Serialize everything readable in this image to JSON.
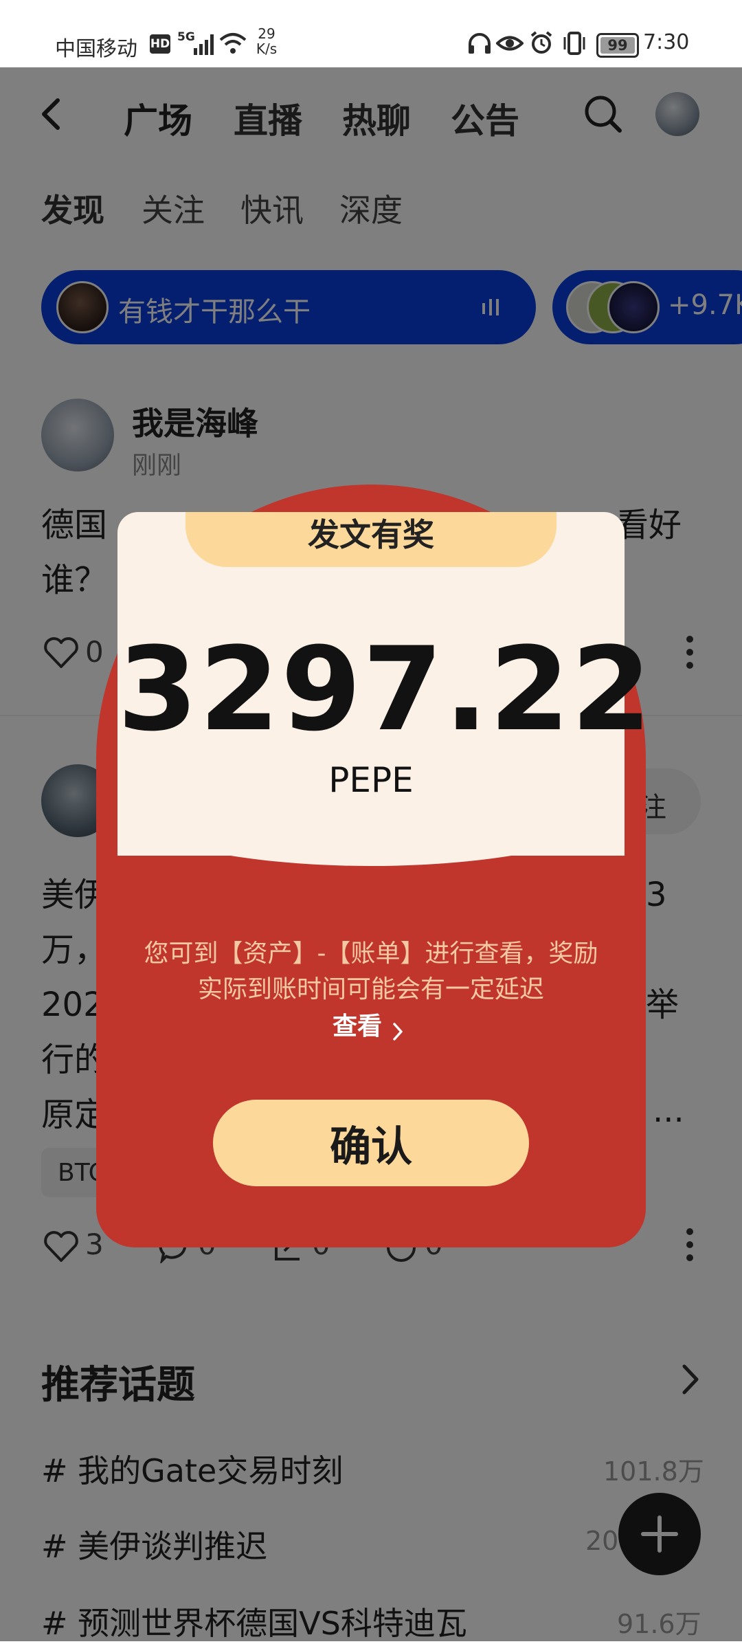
{
  "status": {
    "carrier": "中国移动",
    "hd": "HD",
    "signal": "5G",
    "speed_value": "29",
    "speed_unit": "K/s",
    "battery": "99",
    "time": "7:30"
  },
  "nav": {
    "tabs": [
      {
        "label": "广场"
      },
      {
        "label": "直播"
      },
      {
        "label": "热聊"
      },
      {
        "label": "公告"
      }
    ]
  },
  "subtabs": [
    {
      "label": "发现"
    },
    {
      "label": "关注"
    },
    {
      "label": "快讯"
    },
    {
      "label": "深度"
    }
  ],
  "live": {
    "title": "有钱才干那么干",
    "more_count": "+9.7K"
  },
  "post1": {
    "author": "我是海峰",
    "time": "刚刚",
    "text_line1_start": "德国",
    "text_line1_end": "看好",
    "text_line2": "谁？",
    "likes": "0"
  },
  "post2": {
    "follow_label": "注",
    "text_lines": [
      "美伊",
      "万，",
      "202",
      "行的",
      "原定"
    ],
    "line1_end": "3",
    "line3_end": "举",
    "line5_end": "...",
    "tag": "BTC",
    "likes": "3",
    "comments": "0",
    "shares": "0",
    "reposts": "0"
  },
  "topics": {
    "title": "推荐话题",
    "items": [
      {
        "label": "# 我的Gate交易时刻",
        "count": "101.8万"
      },
      {
        "label": "# 美伊谈判推迟",
        "count": "20"
      },
      {
        "label": "# 预测世界杯德国VS科特迪瓦",
        "count": "91.6万"
      }
    ]
  },
  "modal": {
    "banner": "发文有奖",
    "amount": "3297.22",
    "currency": "PEPE",
    "hint_line1": "您可到【资产】-【账单】进行查看，奖励",
    "hint_line2": "实际到账时间可能会有一定延迟",
    "view_link": "查看",
    "confirm": "确认"
  },
  "colors": {
    "modal_red": "#c0352c",
    "accent_yellow": "#fcd99a",
    "live_blue": "#0a3fe0"
  }
}
